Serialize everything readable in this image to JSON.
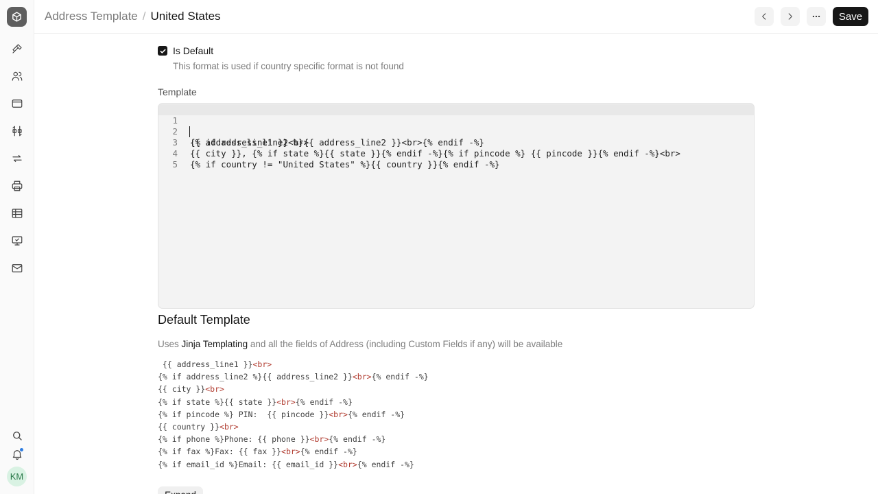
{
  "header": {
    "breadcrumb_parent": "Address Template",
    "breadcrumb_separator": "/",
    "breadcrumb_current": "United States",
    "save_label": "Save"
  },
  "sidebar": {
    "icons": [
      "hammer-icon",
      "users-icon",
      "browser-window-icon",
      "integrations-icon",
      "sync-arrows-icon",
      "printer-icon",
      "table-icon",
      "monitor-icon",
      "mail-icon"
    ],
    "bottom_icons": [
      "search-icon",
      "bell-icon"
    ],
    "avatar_initials": "KM"
  },
  "form": {
    "is_default_label": "Is Default",
    "is_default_checked": true,
    "is_default_description": "This format is used if country specific format is not found",
    "template_label": "Template",
    "template_lines": [
      {
        "num": "1",
        "text": "{{ address_line1 }}<br>"
      },
      {
        "num": "2",
        "text": "{% if address_line2 %}{{ address_line2 }}<br>{% endif -%}"
      },
      {
        "num": "3",
        "text": "{{ city }}, {% if state %}{{ state }}{% endif -%}{% if pincode %} {{ pincode }}{% endif -%}<br>"
      },
      {
        "num": "4",
        "text": "{% if country != \"United States\" %}{{ country }}{% endif -%}"
      },
      {
        "num": "5",
        "text": ""
      }
    ]
  },
  "default_template": {
    "title": "Default Template",
    "desc_prefix": "Uses ",
    "desc_link": "Jinja Templating",
    "desc_suffix": " and all the fields of Address (including Custom Fields if any) will be available",
    "lines": [
      {
        "pre": " {{ address_line1 }}",
        "tag": "<br>",
        "post": ""
      },
      {
        "pre": "{% if address_line2 %}{{ address_line2 }}",
        "tag": "<br>",
        "post": "{% endif -%}"
      },
      {
        "pre": "{{ city }}",
        "tag": "<br>",
        "post": ""
      },
      {
        "pre": "{% if state %}{{ state }}",
        "tag": "<br>",
        "post": "{% endif -%}"
      },
      {
        "pre": "{% if pincode %} PIN:  {{ pincode }}",
        "tag": "<br>",
        "post": "{% endif -%}"
      },
      {
        "pre": "{{ country }}",
        "tag": "<br>",
        "post": ""
      },
      {
        "pre": "{% if phone %}Phone: {{ phone }}",
        "tag": "<br>",
        "post": "{% endif -%}"
      },
      {
        "pre": "{% if fax %}Fax: {{ fax }}",
        "tag": "<br>",
        "post": "{% endif -%}"
      },
      {
        "pre": "{% if email_id %}Email: {{ email_id }}",
        "tag": "<br>",
        "post": "{% endif -%}"
      }
    ],
    "expand_label": "Expand"
  },
  "colors": {
    "primary_button": "#171717",
    "tag_color": "#b03a2e",
    "notification_dot": "#2f7de1"
  }
}
